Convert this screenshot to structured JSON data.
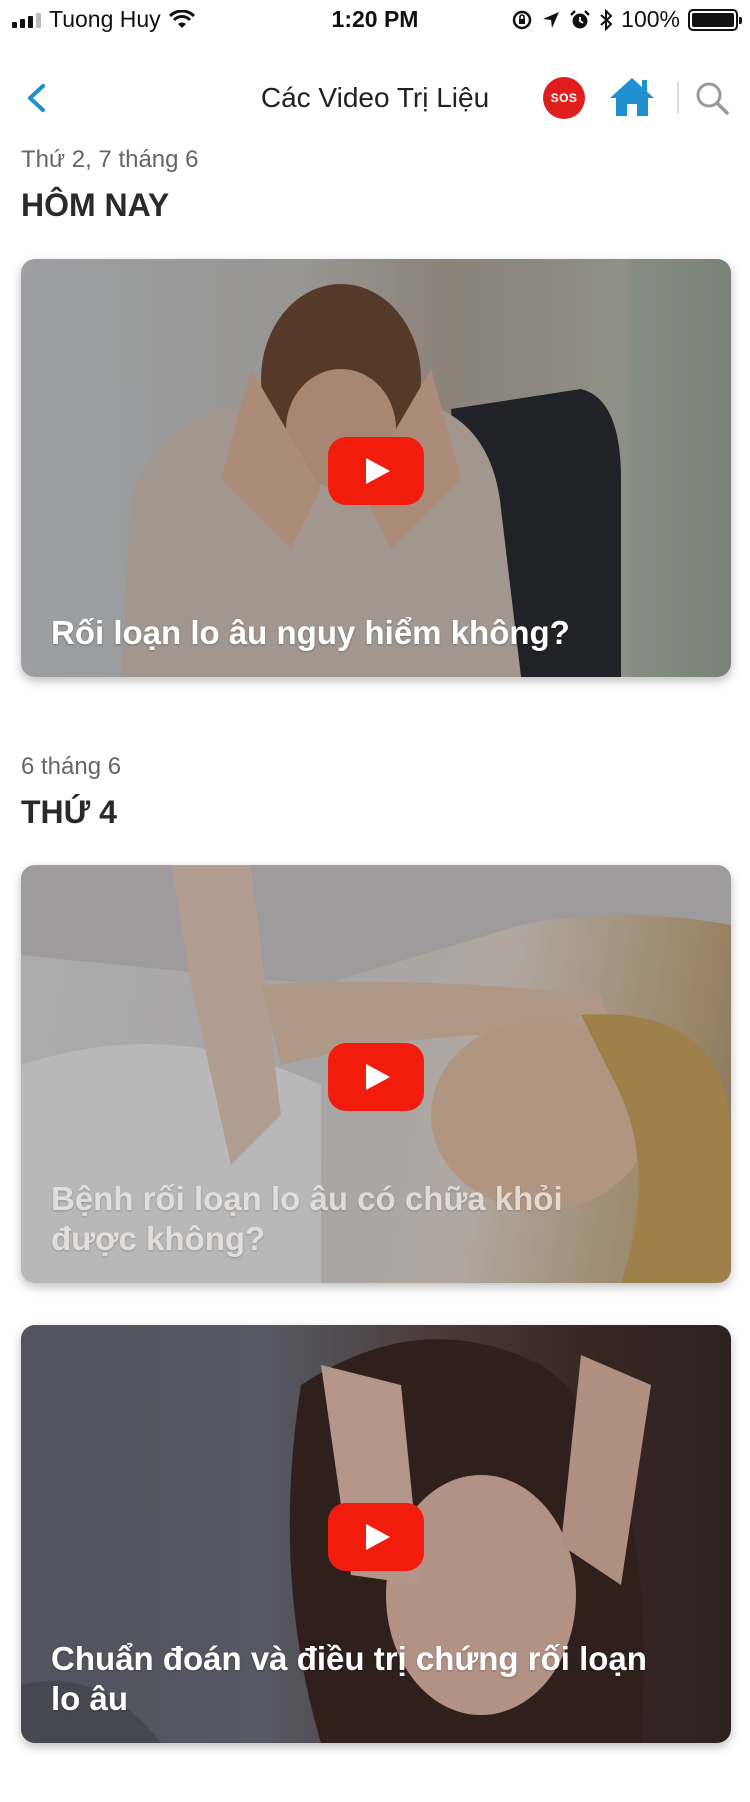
{
  "status_bar": {
    "carrier": "Tuong Huy",
    "time": "1:20 PM",
    "battery": "100%"
  },
  "nav": {
    "title": "Các Video Trị Liệu",
    "sos_label": "SOS"
  },
  "sections": [
    {
      "date": "Thứ 2, 7 tháng 6",
      "heading": "HÔM NAY",
      "videos": [
        {
          "title": "Rối loạn lo âu nguy hiểm không?"
        }
      ]
    },
    {
      "date": "6 tháng 6",
      "heading": "THỨ 4",
      "videos": [
        {
          "title": "Bệnh rối loạn lo âu có chữa khỏi được không?"
        },
        {
          "title": "Chuẩn đoán và điều trị chứng rối loạn lo âu"
        }
      ]
    }
  ],
  "colors": {
    "accent": "#1e8fd0",
    "sos": "#e01e1e",
    "play": "#f21c0d"
  },
  "icons": [
    "back-icon",
    "sos-icon",
    "home-icon",
    "search-icon",
    "play-icon"
  ]
}
